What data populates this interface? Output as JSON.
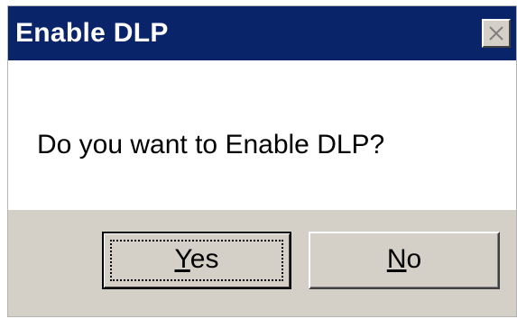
{
  "window": {
    "title": "Enable DLP",
    "close_icon": "close-icon"
  },
  "message": {
    "text": "Do you want to Enable DLP?"
  },
  "buttons": {
    "yes": {
      "mnemonic": "Y",
      "rest": "es",
      "focused": true
    },
    "no": {
      "mnemonic": "N",
      "rest": "o",
      "focused": false
    }
  },
  "colors": {
    "titlebar": "#0a246a",
    "title_text": "#ffffff",
    "face": "#d4d0c8",
    "content": "#ffffff"
  }
}
